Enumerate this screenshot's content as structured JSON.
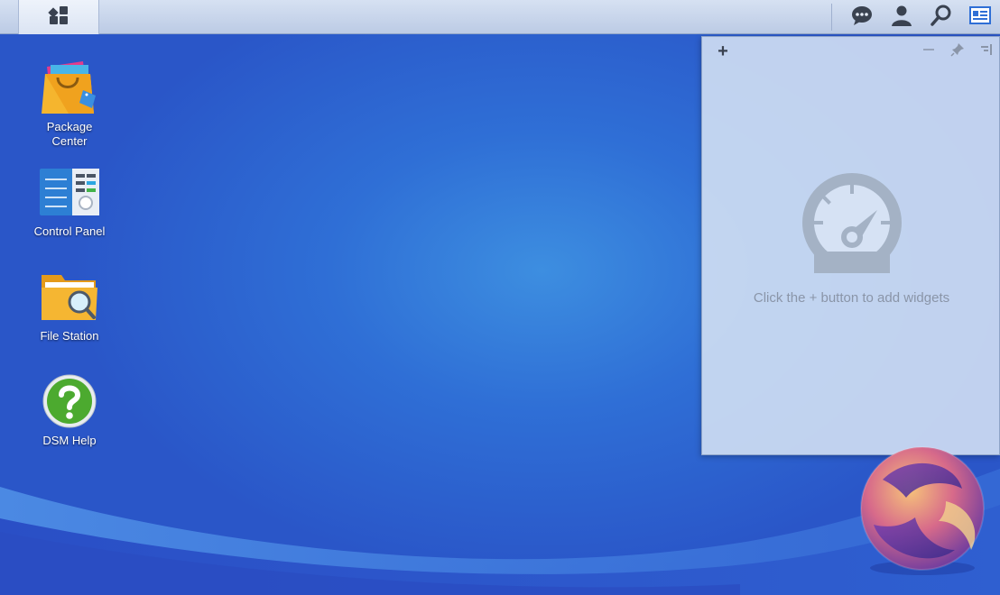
{
  "taskbar": {
    "main_menu_icon": "apps-grid-icon",
    "icons": [
      "notifications-icon",
      "user-icon",
      "search-icon",
      "widgets-icon"
    ]
  },
  "desktop": {
    "shortcuts": [
      {
        "label_line1": "Package",
        "label_line2": "Center",
        "icon": "package-center-icon"
      },
      {
        "label": "Control Panel",
        "icon": "control-panel-icon"
      },
      {
        "label": "File Station",
        "icon": "file-station-icon"
      },
      {
        "label": "DSM Help",
        "icon": "dsm-help-icon"
      }
    ]
  },
  "widgets": {
    "add_label": "+",
    "empty_hint": "Click the + button to add widgets"
  },
  "colors": {
    "accent": "#2f6fd6",
    "taskbar": "#c9d6ec",
    "panel": "#d6e2f4",
    "hint_text": "#8a95a8"
  }
}
